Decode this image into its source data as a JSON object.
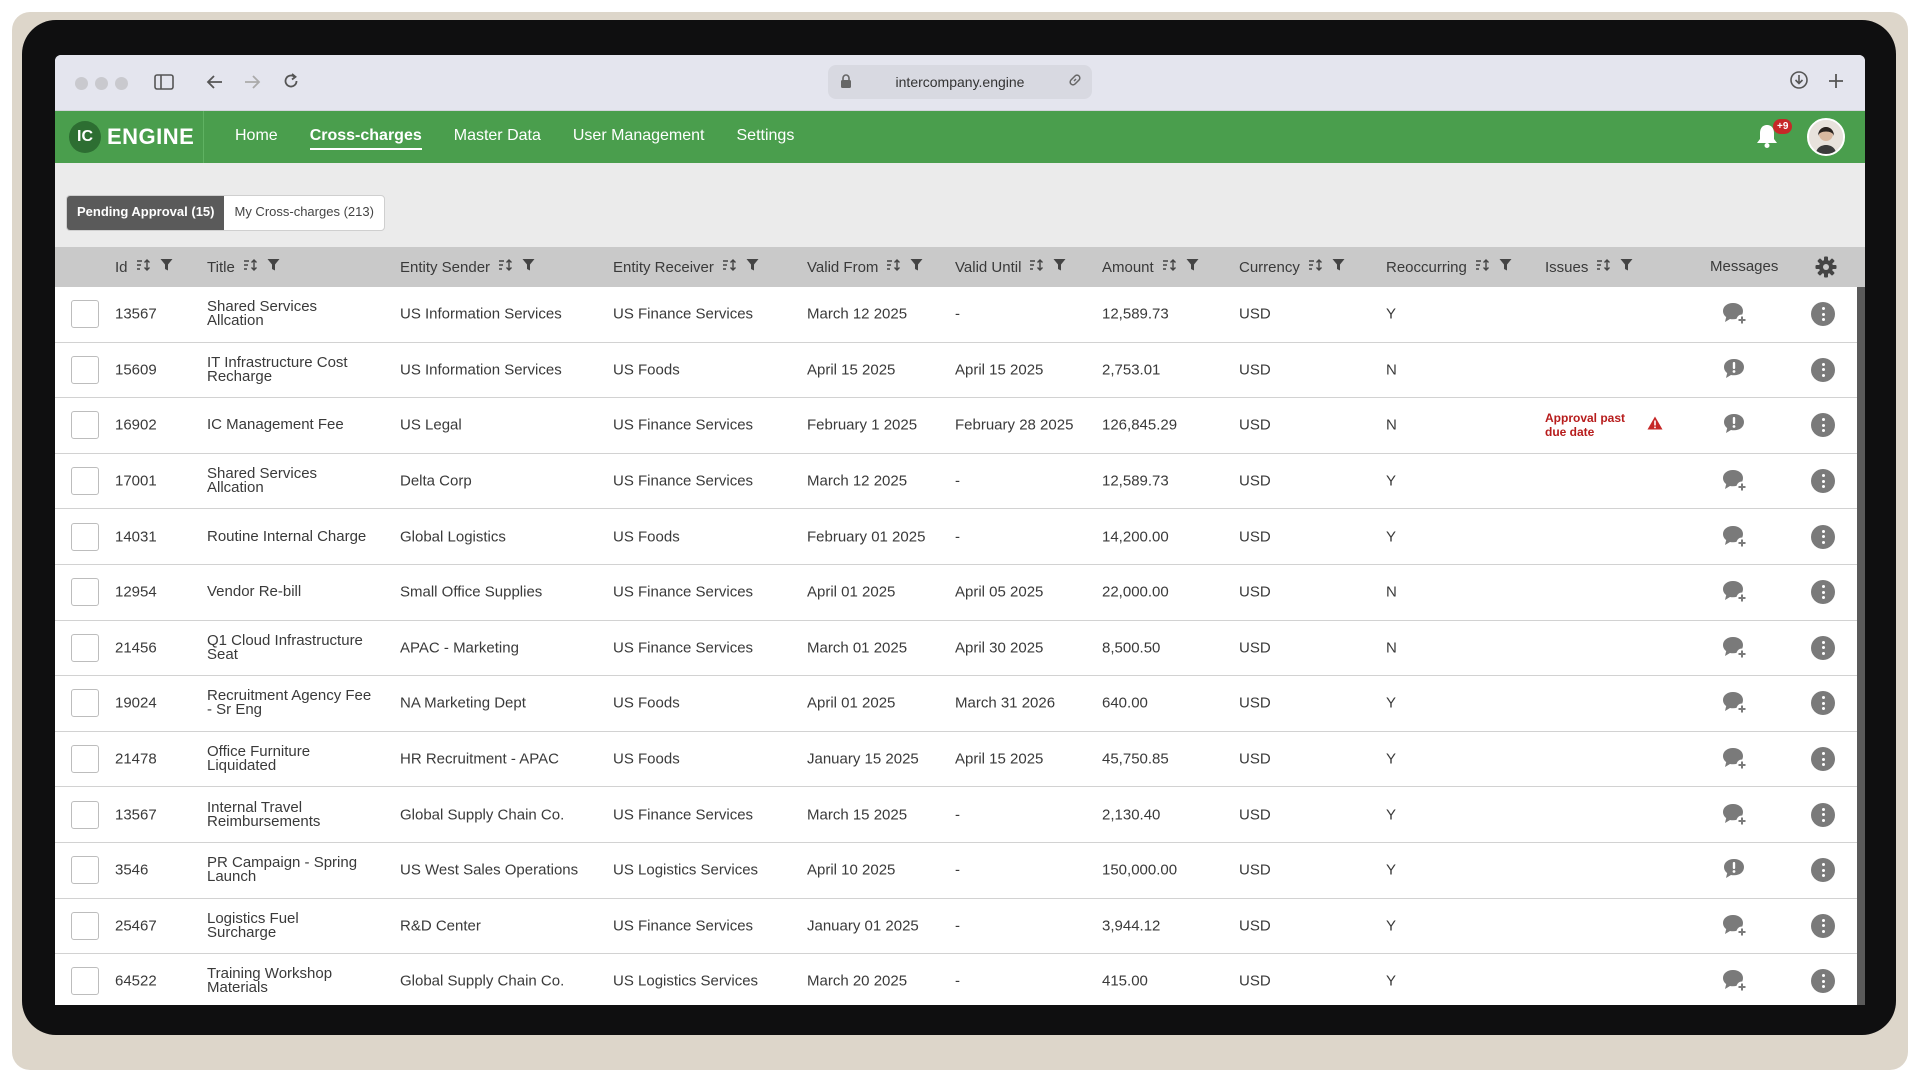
{
  "browser": {
    "url": "intercompany.engine"
  },
  "app": {
    "logo_badge": "IC",
    "logo_word": "ENGINE",
    "nav": [
      "Home",
      "Cross-charges",
      "Master Data",
      "User Management",
      "Settings"
    ],
    "active_nav": "Cross-charges",
    "notifications": "+9",
    "accent_color": "#4a9e4d",
    "alert_color": "#c62828"
  },
  "tabs": {
    "pending": "Pending Approval (15)",
    "mine": "My Cross-charges (213)"
  },
  "columns": [
    "Id",
    "Title",
    "Entity Sender",
    "Entity Receiver",
    "Valid From",
    "Valid Until",
    "Amount",
    "Currency",
    "Reoccurring",
    "Issues",
    "Messages"
  ],
  "rows": [
    {
      "id": "13567",
      "title": "Shared Services Allcation",
      "sender": "US Information Services",
      "receiver": "US Finance Services",
      "from": "March 12 2025",
      "until": "-",
      "amount": "12,589.73",
      "currency": "USD",
      "reoccurring": "Y",
      "issue": "",
      "msg": "add"
    },
    {
      "id": "15609",
      "title": "IT Infrastructure Cost Recharge",
      "sender": "US Information Services",
      "receiver": "US Foods",
      "from": "April 15 2025",
      "until": "April 15 2025",
      "amount": "2,753.01",
      "currency": "USD",
      "reoccurring": "N",
      "issue": "",
      "msg": "alert"
    },
    {
      "id": "16902",
      "title": "IC Management Fee",
      "sender": "US Legal",
      "receiver": "US Finance Services",
      "from": "February 1 2025",
      "until": "February 28 2025",
      "amount": "126,845.29",
      "currency": "USD",
      "reoccurring": "N",
      "issue": "Approval past due date",
      "msg": "alert"
    },
    {
      "id": "17001",
      "title": "Shared Services Allcation",
      "sender": "Delta Corp",
      "receiver": "US Finance Services",
      "from": "March 12 2025",
      "until": "-",
      "amount": "12,589.73",
      "currency": "USD",
      "reoccurring": "Y",
      "issue": "",
      "msg": "add"
    },
    {
      "id": "14031",
      "title": "Routine Internal Charge",
      "sender": "Global Logistics",
      "receiver": "US Foods",
      "from": "February 01 2025",
      "until": "-",
      "amount": "14,200.00",
      "currency": "USD",
      "reoccurring": "Y",
      "issue": "",
      "msg": "add"
    },
    {
      "id": "12954",
      "title": "Vendor Re-bill",
      "sender": "Small Office Supplies",
      "receiver": "US Finance Services",
      "from": "April 01 2025",
      "until": "April 05 2025",
      "amount": "22,000.00",
      "currency": "USD",
      "reoccurring": "N",
      "issue": "",
      "msg": "add"
    },
    {
      "id": "21456",
      "title": "Q1 Cloud Infrastructure Seat",
      "sender": "APAC - Marketing",
      "receiver": "US Finance Services",
      "from": "March 01 2025",
      "until": "April 30 2025",
      "amount": "8,500.50",
      "currency": "USD",
      "reoccurring": "N",
      "issue": "",
      "msg": "add"
    },
    {
      "id": "19024",
      "title": "Recruitment Agency Fee - Sr Eng",
      "sender": "NA Marketing Dept",
      "receiver": "US Foods",
      "from": "April 01 2025",
      "until": "March 31 2026",
      "amount": "640.00",
      "currency": "USD",
      "reoccurring": "Y",
      "issue": "",
      "msg": "add"
    },
    {
      "id": "21478",
      "title": "Office Furniture Liquidated",
      "sender": "HR Recruitment - APAC",
      "receiver": "US Foods",
      "from": "January 15 2025",
      "until": "April 15 2025",
      "amount": "45,750.85",
      "currency": "USD",
      "reoccurring": "Y",
      "issue": "",
      "msg": "add"
    },
    {
      "id": "13567",
      "title": "Internal Travel Reimbursements",
      "sender": "Global Supply Chain Co.",
      "receiver": "US Finance Services",
      "from": "March 15 2025",
      "until": "-",
      "amount": "2,130.40",
      "currency": "USD",
      "reoccurring": "Y",
      "issue": "",
      "msg": "add"
    },
    {
      "id": "3546",
      "title": "PR Campaign - Spring Launch",
      "sender": "US West Sales Operations",
      "receiver": "US Logistics Services",
      "from": "April 10 2025",
      "until": "-",
      "amount": "150,000.00",
      "currency": "USD",
      "reoccurring": "Y",
      "issue": "",
      "msg": "alert"
    },
    {
      "id": "25467",
      "title": "Logistics Fuel Surcharge",
      "sender": "R&D Center",
      "receiver": "US Finance Services",
      "from": "January 01 2025",
      "until": "-",
      "amount": "3,944.12",
      "currency": "USD",
      "reoccurring": "Y",
      "issue": "",
      "msg": "add"
    },
    {
      "id": "64522",
      "title": "Training Workshop Materials",
      "sender": "Global Supply Chain Co.",
      "receiver": "US Logistics Services",
      "from": "March 20 2025",
      "until": "-",
      "amount": "415.00",
      "currency": "USD",
      "reoccurring": "Y",
      "issue": "",
      "msg": "add"
    }
  ]
}
